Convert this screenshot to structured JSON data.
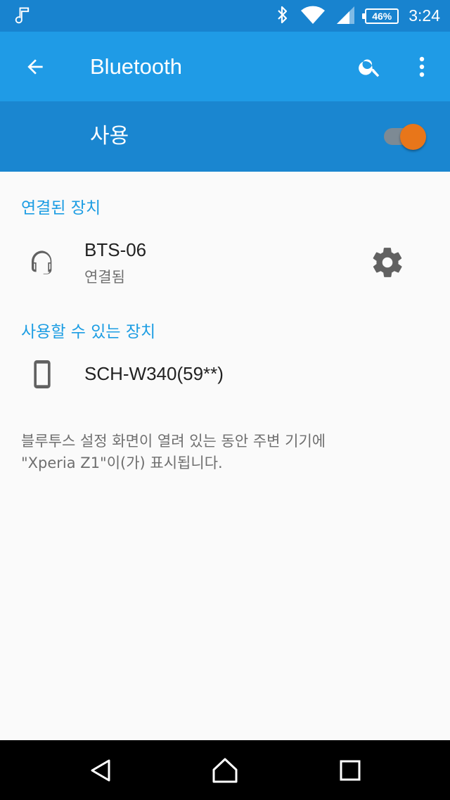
{
  "status_bar": {
    "time": "3:24",
    "battery": "46%",
    "icons": [
      "music-note-icon",
      "bluetooth-icon",
      "wifi-icon",
      "cell-signal-icon",
      "battery-icon"
    ]
  },
  "app_bar": {
    "title": "Bluetooth",
    "icons": [
      "back-arrow-icon",
      "search-icon",
      "more-vert-icon"
    ]
  },
  "toggle": {
    "label": "사용",
    "state": "on",
    "thumb_color": "#e8761a"
  },
  "connected_section": {
    "header": "연결된 장치",
    "devices": [
      {
        "name": "BTS-06",
        "status": "연결됨",
        "icon": "headset-icon",
        "action_icon": "gear-icon"
      }
    ]
  },
  "available_section": {
    "header": "사용할 수 있는 장치",
    "devices": [
      {
        "name": "SCH-W340(59**)",
        "icon": "phone-icon"
      }
    ]
  },
  "info_text": {
    "line1": "블루투스 설정 화면이 열려 있는 동안 주변 기기에",
    "line2": "\"Xperia Z1\"이(가) 표시됩니다."
  },
  "nav_bar": {
    "icons": [
      "back-triangle-icon",
      "home-icon",
      "recents-icon"
    ]
  },
  "colors": {
    "status_bar": "#1883cf",
    "app_bar": "#1f9be6",
    "toggle_bar": "#1a86d0",
    "accent": "#1c9de3"
  }
}
